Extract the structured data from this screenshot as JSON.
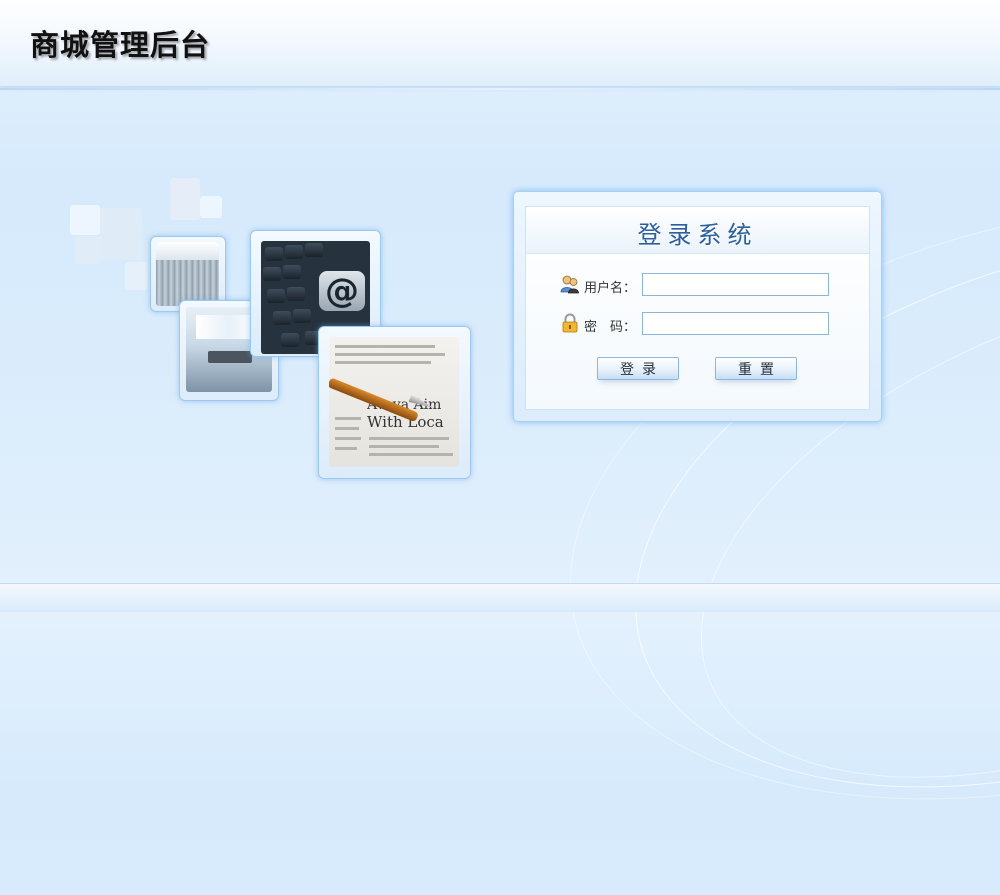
{
  "header": {
    "title": "商城管理后台"
  },
  "collage": {
    "paper_headline_1": "Avaya Aim",
    "paper_headline_2": "With Loca",
    "at_symbol": "@"
  },
  "login": {
    "title": "登录系统",
    "username": {
      "label": "用户名：",
      "value": "",
      "placeholder": "",
      "icon": "user-icon"
    },
    "password": {
      "label": "密　码：",
      "value": "",
      "placeholder": "",
      "icon": "lock-icon"
    },
    "login_button": "登录",
    "reset_button": "重置"
  },
  "colors": {
    "accent": "#2c5f9c",
    "panel_border": "#a7d0f2",
    "background": "#dcedfc"
  }
}
